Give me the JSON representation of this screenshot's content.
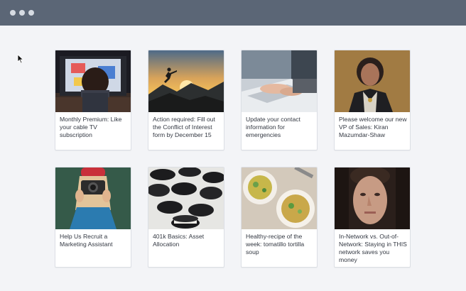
{
  "window": {
    "controls": [
      "window-dot",
      "window-dot",
      "window-dot"
    ]
  },
  "cards": [
    {
      "title": "Monthly Premium: Like your cable TV subscription",
      "image_icon": "child-watching-tv-photo"
    },
    {
      "title": "Action required: Fill out the Conflict of Interest form by December 15",
      "image_icon": "person-jumping-sunset-photo"
    },
    {
      "title": "Update your contact information for emergencies",
      "image_icon": "hands-typing-laptop-photo"
    },
    {
      "title": "Please welcome our new VP of Sales: Kiran Mazumdar-Shaw",
      "image_icon": "woman-portrait-photo"
    },
    {
      "title": "Help Us Recruit a Marketing Assistant",
      "image_icon": "woman-with-camera-photo"
    },
    {
      "title": "401k Basics: Asset Allocation",
      "image_icon": "cookies-photo"
    },
    {
      "title": "Healthy-recipe of the week: tomatillo tortilla soup",
      "image_icon": "soup-bowls-photo"
    },
    {
      "title": "In-Network vs. Out-of-Network: Staying in THIS network saves you money",
      "image_icon": "man-portrait-photo"
    }
  ],
  "colors": {
    "titlebar": "#5b6676",
    "background": "#f3f4f7",
    "card": "#ffffff"
  }
}
